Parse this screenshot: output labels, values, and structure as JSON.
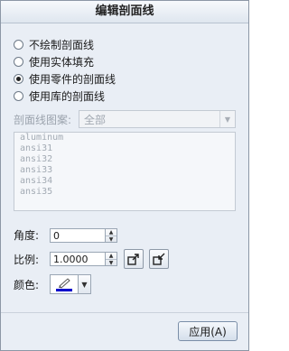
{
  "title": "编辑剖面线",
  "radio_options": [
    {
      "label": "不绘制剖面线",
      "checked": false
    },
    {
      "label": "使用实体填充",
      "checked": false
    },
    {
      "label": "使用零件的剖面线",
      "checked": true
    },
    {
      "label": "使用库的剖面线",
      "checked": false
    }
  ],
  "pattern": {
    "label": "剖面线图案:",
    "value": "全部"
  },
  "pattern_list": [
    "aluminum",
    "ansi31",
    "ansi32",
    "ansi33",
    "ansi34",
    "ansi35"
  ],
  "angle": {
    "label": "角度:",
    "value": "0"
  },
  "scale": {
    "label": "比例:",
    "value": "1.0000"
  },
  "color": {
    "label": "颜色:",
    "swatch": "#0000cc"
  },
  "apply_label": "应用(A)"
}
